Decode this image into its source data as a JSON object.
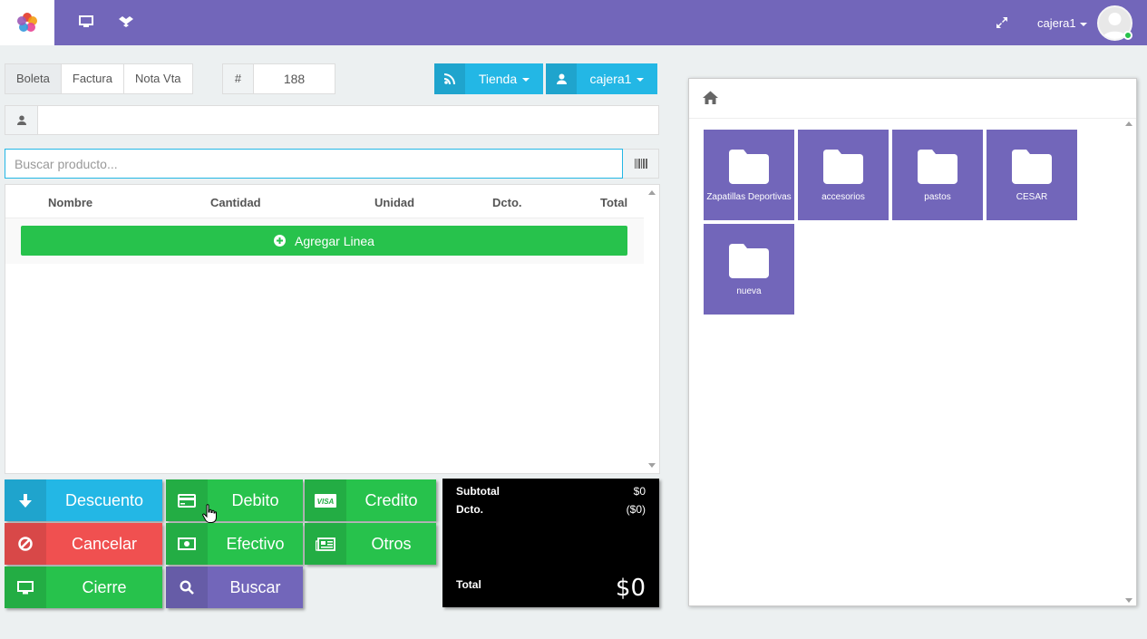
{
  "topbar": {
    "logo_icon": "flower-logo-icon",
    "icons": [
      "desktop-icon",
      "dropbox-icon"
    ],
    "expand_icon": "expand-icon",
    "user": "cajera1"
  },
  "doc_tabs": [
    "Boleta",
    "Factura",
    "Nota Vta"
  ],
  "doc_tab_active": "Boleta",
  "number": {
    "hash": "#",
    "value": "188"
  },
  "tienda_button": "Tienda",
  "user_button": "cajera1",
  "client": {
    "value": ""
  },
  "search": {
    "placeholder": "Buscar producto..."
  },
  "table": {
    "columns": [
      "Nombre",
      "Cantidad",
      "Unidad",
      "Dcto.",
      "Total"
    ],
    "add_line_label": "Agregar Linea"
  },
  "actions": {
    "descuento": "Descuento",
    "debito": "Debito",
    "credito": "Credito",
    "cancelar": "Cancelar",
    "efectivo": "Efectivo",
    "otros": "Otros",
    "cierre": "Cierre",
    "buscar": "Buscar"
  },
  "totals": {
    "subtotal_label": "Subtotal",
    "subtotal_value": "$0",
    "dcto_label": "Dcto.",
    "dcto_value": "($0)",
    "total_label": "Total",
    "total_value": "$0"
  },
  "categories": [
    "Zapatillas Deportivas",
    "accesorios",
    "pastos",
    "CESAR",
    "nueva"
  ],
  "colors": {
    "topbar": "#7266ba",
    "info": "#23b7e5",
    "success": "#27c24c",
    "danger": "#f05050",
    "primary": "#7266ba"
  }
}
